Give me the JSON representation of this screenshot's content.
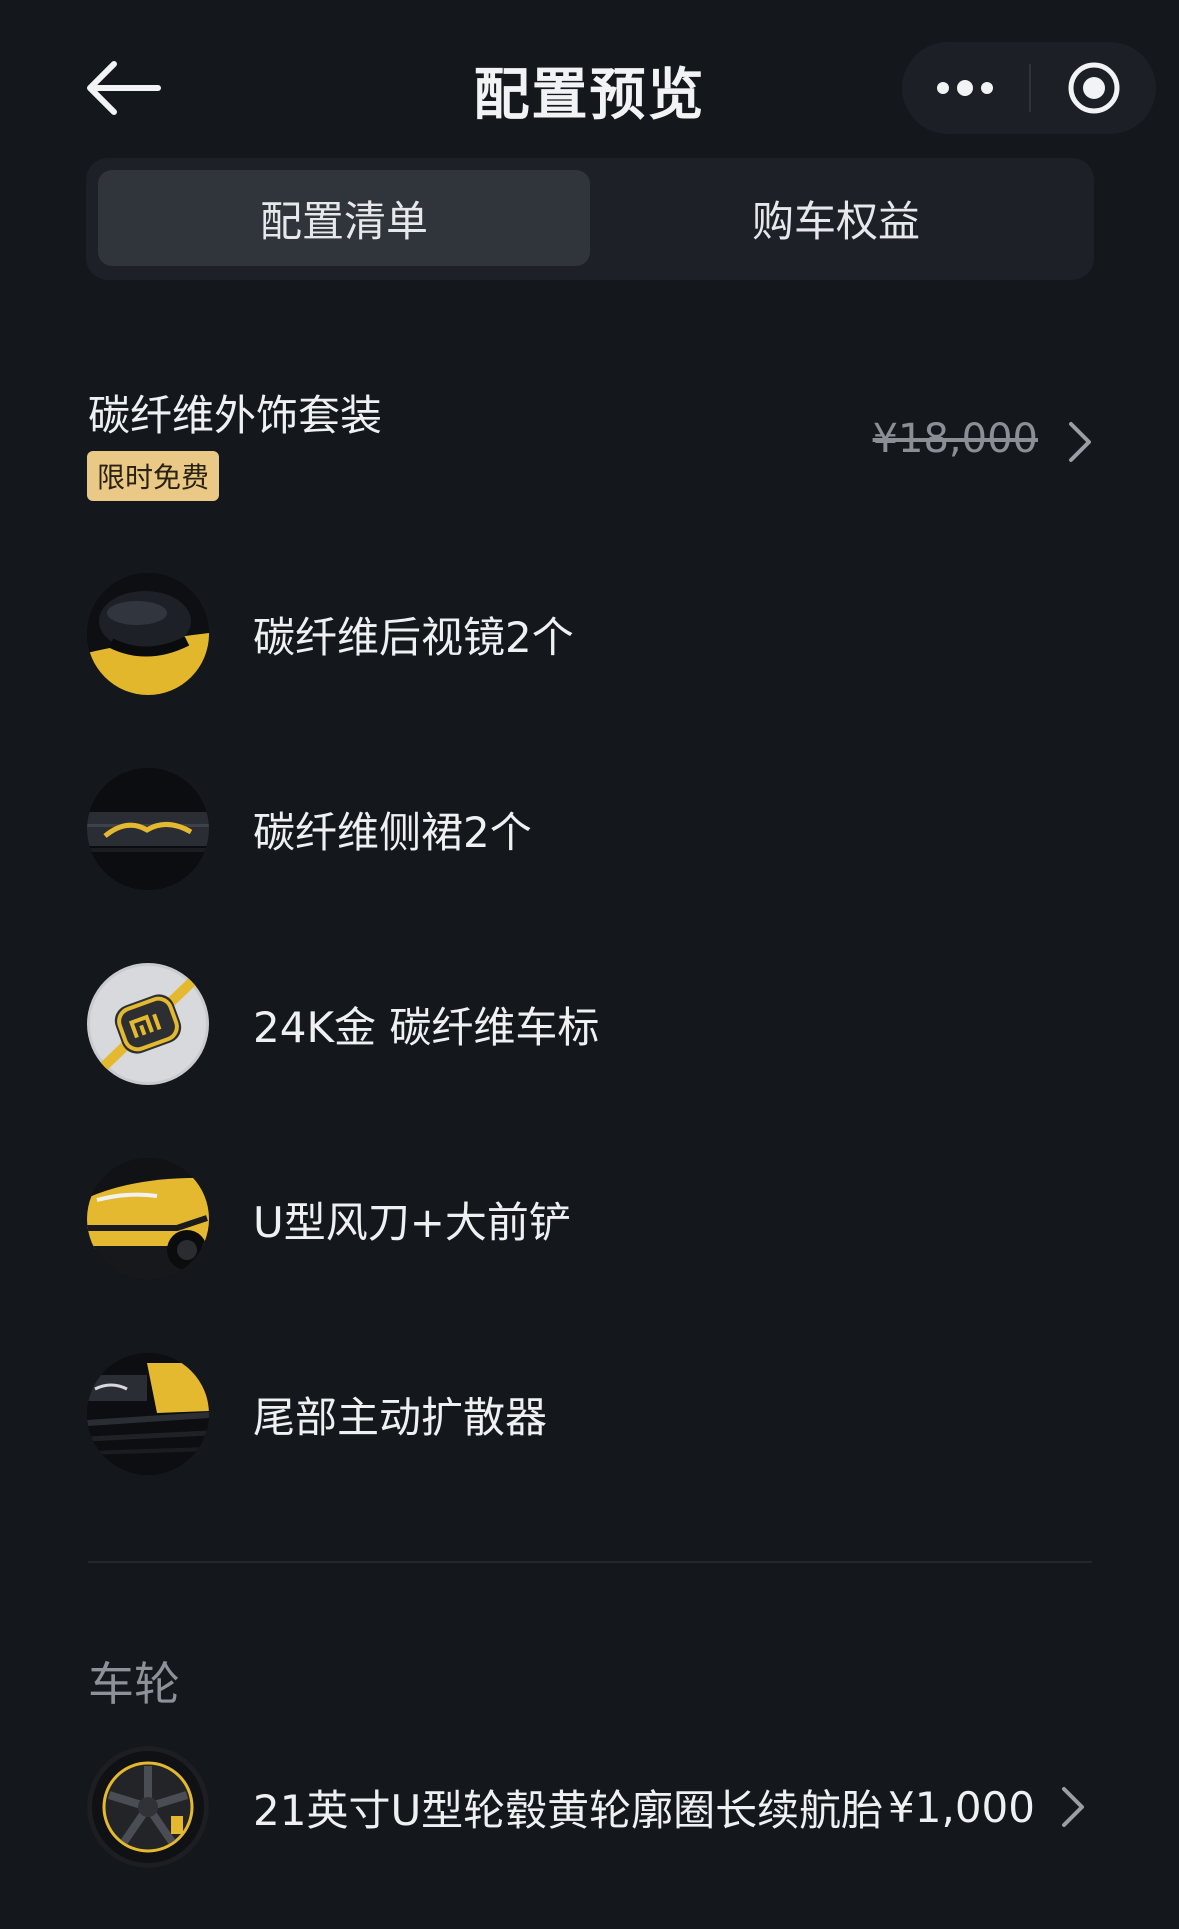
{
  "header": {
    "title": "配置预览",
    "back_icon": "arrow-left-icon",
    "more_icon": "more-dots-icon",
    "target_icon": "record-circle-icon"
  },
  "tabs": [
    {
      "label": "配置清单",
      "active": true
    },
    {
      "label": "购车权益",
      "active": false
    }
  ],
  "package": {
    "title": "碳纤维外饰套装",
    "badge": "限时免费",
    "original_price": "¥18,000"
  },
  "items": [
    {
      "label": "碳纤维后视镜2个",
      "thumb": "mirror"
    },
    {
      "label": "碳纤维侧裙2个",
      "thumb": "side-skirt"
    },
    {
      "label": "24K金 碳纤维车标",
      "thumb": "badge"
    },
    {
      "label": "U型风刀+大前铲",
      "thumb": "front"
    },
    {
      "label": "尾部主动扩散器",
      "thumb": "rear"
    }
  ],
  "wheels": {
    "section_title": "车轮",
    "item_label": "21英寸U型轮毂黄轮廓圈长续航胎",
    "price": "¥1,000"
  },
  "colors": {
    "background": "#14171c",
    "badge": "#e9c985",
    "accent_yellow": "#e5b92f"
  }
}
